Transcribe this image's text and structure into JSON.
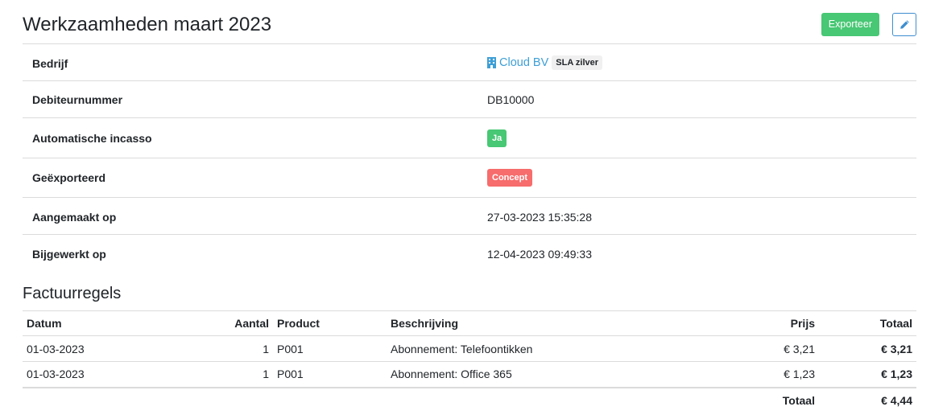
{
  "header": {
    "title": "Werkzaamheden maart 2023",
    "export_label": "Exporteer",
    "edit_icon": "pencil-icon"
  },
  "details": {
    "company_label": "Bedrijf",
    "company_icon": "building-icon",
    "company_name": "Cloud BV",
    "company_sla": "SLA zilver",
    "debtor_label": "Debiteurnummer",
    "debtor_value": "DB10000",
    "direct_debit_label": "Automatische incasso",
    "direct_debit_value": "Ja",
    "exported_label": "Geëxporteerd",
    "exported_value": "Concept",
    "created_label": "Aangemaakt op",
    "created_value": "27-03-2023 15:35:28",
    "updated_label": "Bijgewerkt op",
    "updated_value": "12-04-2023 09:49:33"
  },
  "lines": {
    "title": "Factuurregels",
    "columns": {
      "date": "Datum",
      "quantity": "Aantal",
      "product": "Product",
      "description": "Beschrijving",
      "price": "Prijs",
      "total": "Totaal"
    },
    "rows": [
      {
        "date": "01-03-2023",
        "quantity": "1",
        "product": "P001",
        "description": "Abonnement: Telefoontikken",
        "price": "€ 3,21",
        "total": "€ 3,21"
      },
      {
        "date": "01-03-2023",
        "quantity": "1",
        "product": "P001",
        "description": "Abonnement: Office 365",
        "price": "€ 1,23",
        "total": "€ 1,23"
      }
    ],
    "footer_label": "Totaal",
    "footer_total": "€ 4,44"
  },
  "colors": {
    "success": "#48c774",
    "danger": "#f76c6c",
    "link": "#3e9fd6",
    "primary": "#3e8ed0"
  }
}
